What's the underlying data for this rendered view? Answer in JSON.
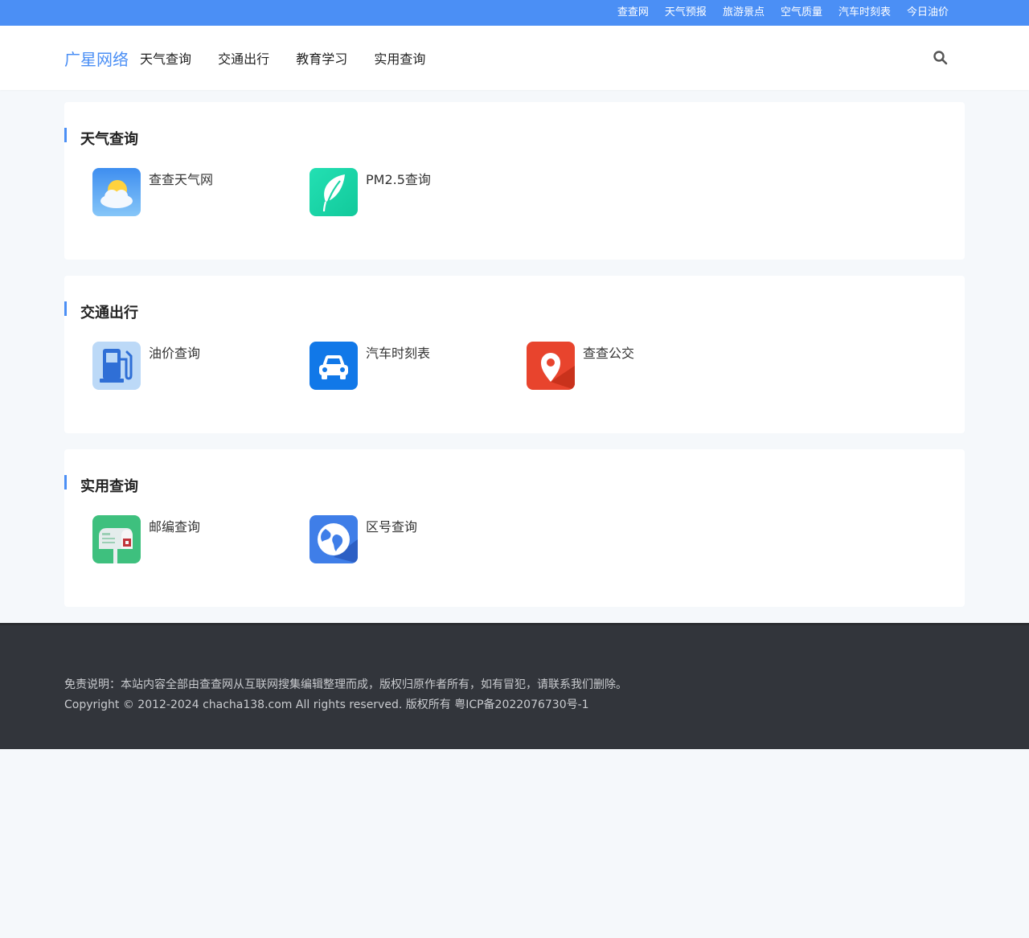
{
  "topbar": {
    "links": [
      "查查网",
      "天气预报",
      "旅游景点",
      "空气质量",
      "汽车时刻表",
      "今日油价"
    ]
  },
  "header": {
    "logo": "广星网络",
    "nav": [
      "天气查询",
      "交通出行",
      "教育学习",
      "实用查询"
    ],
    "search_icon": "search-icon"
  },
  "sections": [
    {
      "title": "天气查询",
      "items": [
        {
          "label": "查查天气网",
          "icon": "weather-sun-cloud-icon"
        },
        {
          "label": "PM2.5查询",
          "icon": "leaf-icon"
        }
      ]
    },
    {
      "title": "交通出行",
      "items": [
        {
          "label": "油价查询",
          "icon": "fuel-pump-icon"
        },
        {
          "label": "汽车时刻表",
          "icon": "car-icon"
        },
        {
          "label": "查查公交",
          "icon": "map-pin-icon"
        }
      ]
    },
    {
      "title": "实用查询",
      "items": [
        {
          "label": "邮编查询",
          "icon": "mailbox-icon"
        },
        {
          "label": "区号查询",
          "icon": "globe-icon"
        }
      ]
    }
  ],
  "footer": {
    "disclaimer": "免责说明：本站内容全部由查查网从互联网搜集编辑整理而成，版权归原作者所有，如有冒犯，请联系我们删除。",
    "copyright": "Copyright © 2012-2024 chacha138.com All rights reserved. 版权所有 粤ICP备2022076730号-1"
  },
  "colors": {
    "accent": "#4b8ff5",
    "footer_bg": "#32353b",
    "page_bg": "#f5f8fb"
  }
}
